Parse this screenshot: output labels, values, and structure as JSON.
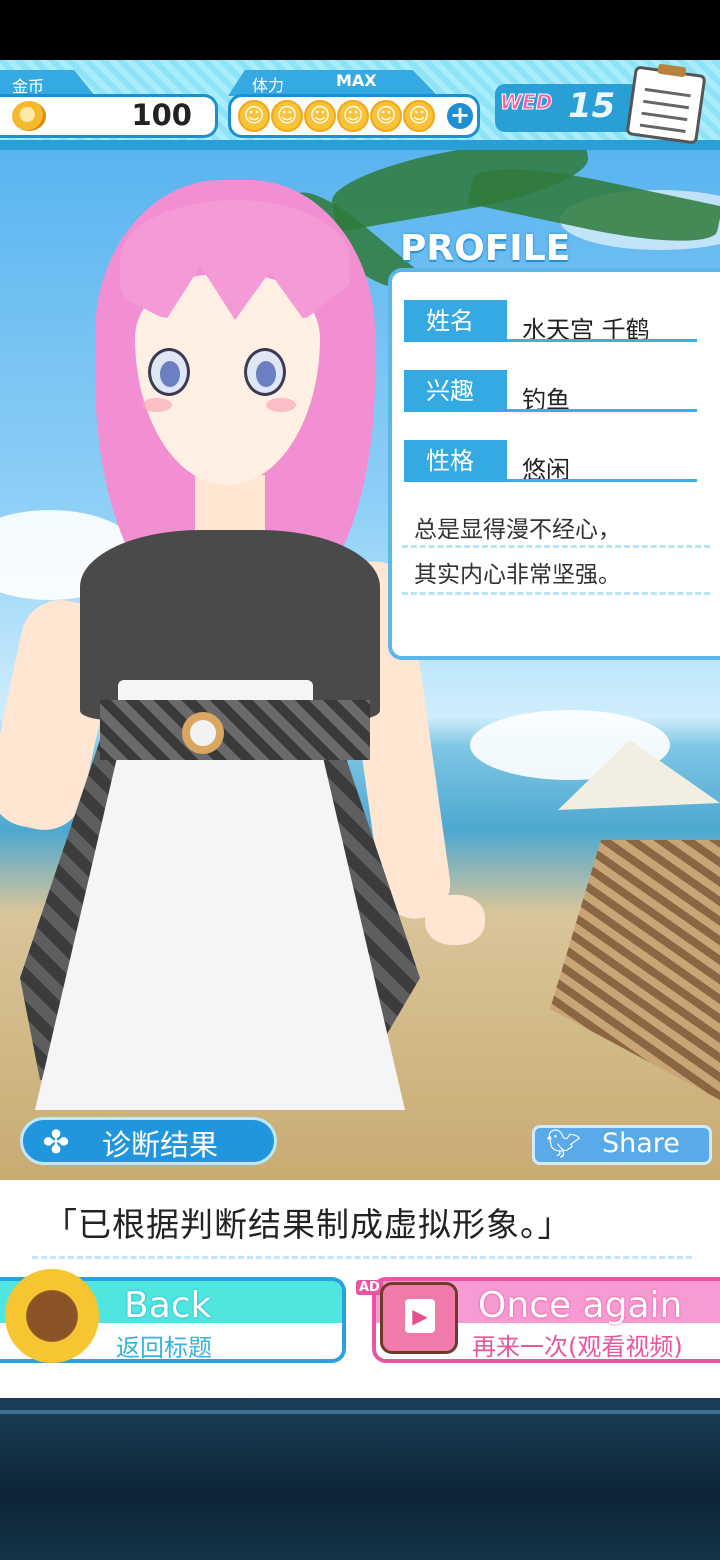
{
  "hud": {
    "gold_label": "金币",
    "gold_value": "100",
    "stamina_label": "体力",
    "stamina_max": "MAX",
    "stamina_count": 6,
    "weekday": "WED",
    "day": "15"
  },
  "profile": {
    "title": "PROFILE",
    "rows": [
      {
        "label": "姓名",
        "value": "水天宫 千鹤"
      },
      {
        "label": "兴趣",
        "value": "钓鱼"
      },
      {
        "label": "性格",
        "value": "悠闲"
      }
    ],
    "description": [
      "总是显得漫不经心，",
      "其实内心非常坚强。"
    ]
  },
  "buttons": {
    "diagnosis": "诊断结果",
    "share": "Share",
    "back_en": "Back",
    "back_cn": "返回标题",
    "again_en": "Once again",
    "again_cn": "再来一次(观看视频)",
    "ad": "AD"
  },
  "message": "「已根据判断结果制成虚拟形象。」",
  "colors": {
    "hud_blue": "#2a9fd6",
    "profile_label": "#35a9e2",
    "back_accent": "#4fe6e0",
    "again_accent": "#f79bd3"
  },
  "icons": {
    "coin": "coin-icon",
    "stamina": "smile-icon",
    "plus": "plus-icon",
    "memo": "memo-icon",
    "clover": "clover-icon",
    "share": "twitter-bird-icon",
    "sunflower": "sunflower-icon",
    "tv": "tv-icon"
  }
}
